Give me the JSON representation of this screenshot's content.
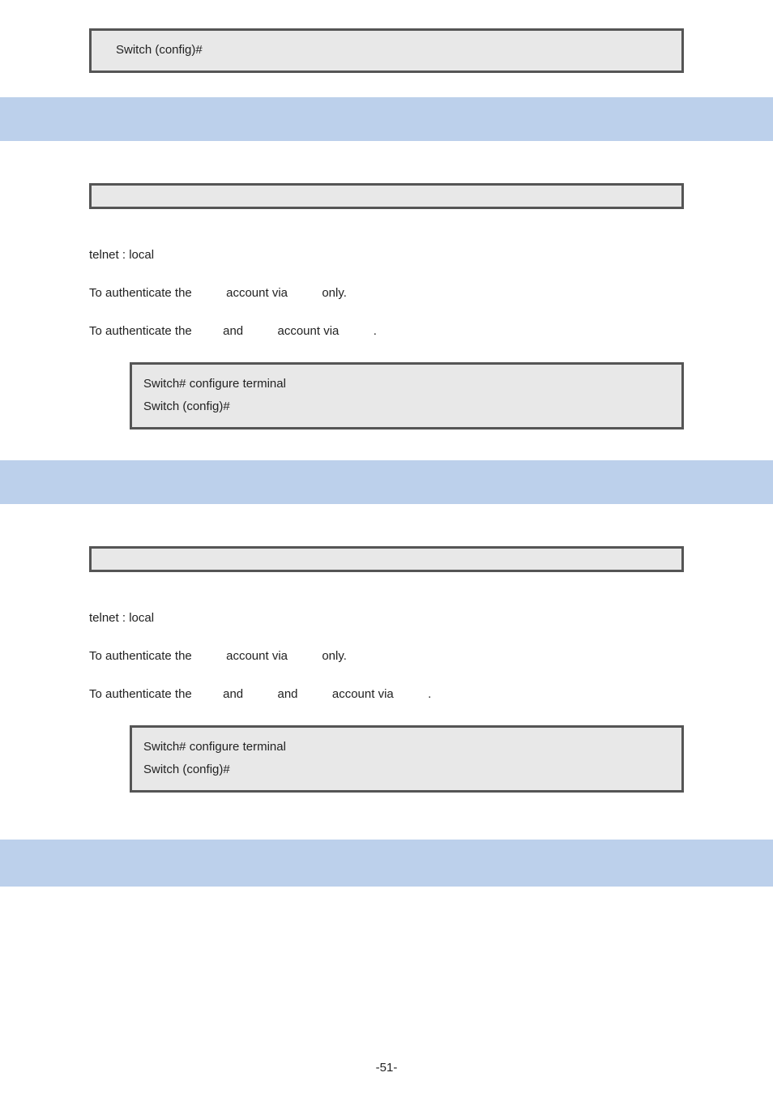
{
  "topbox": {
    "line1": "Switch (config)#"
  },
  "sec1": {
    "default_line": "telnet : local",
    "auth1_a": "To authenticate the",
    "auth1_b": "account via",
    "auth1_c": "only.",
    "auth2_a": "To authenticate the",
    "auth2_b": "and",
    "auth2_c": "account via",
    "auth2_d": ".",
    "box_line1": "Switch# configure terminal",
    "box_line2": "Switch (config)#"
  },
  "sec2": {
    "default_line": "telnet : local",
    "auth1_a": "To authenticate the",
    "auth1_b": "account via",
    "auth1_c": "only.",
    "auth2_a": "To authenticate the",
    "auth2_b": "and",
    "auth2_c": "and",
    "auth2_d": "account via",
    "auth2_e": ".",
    "box_line1": "Switch# configure terminal",
    "box_line2": "Switch (config)#"
  },
  "page_number": "-51-"
}
